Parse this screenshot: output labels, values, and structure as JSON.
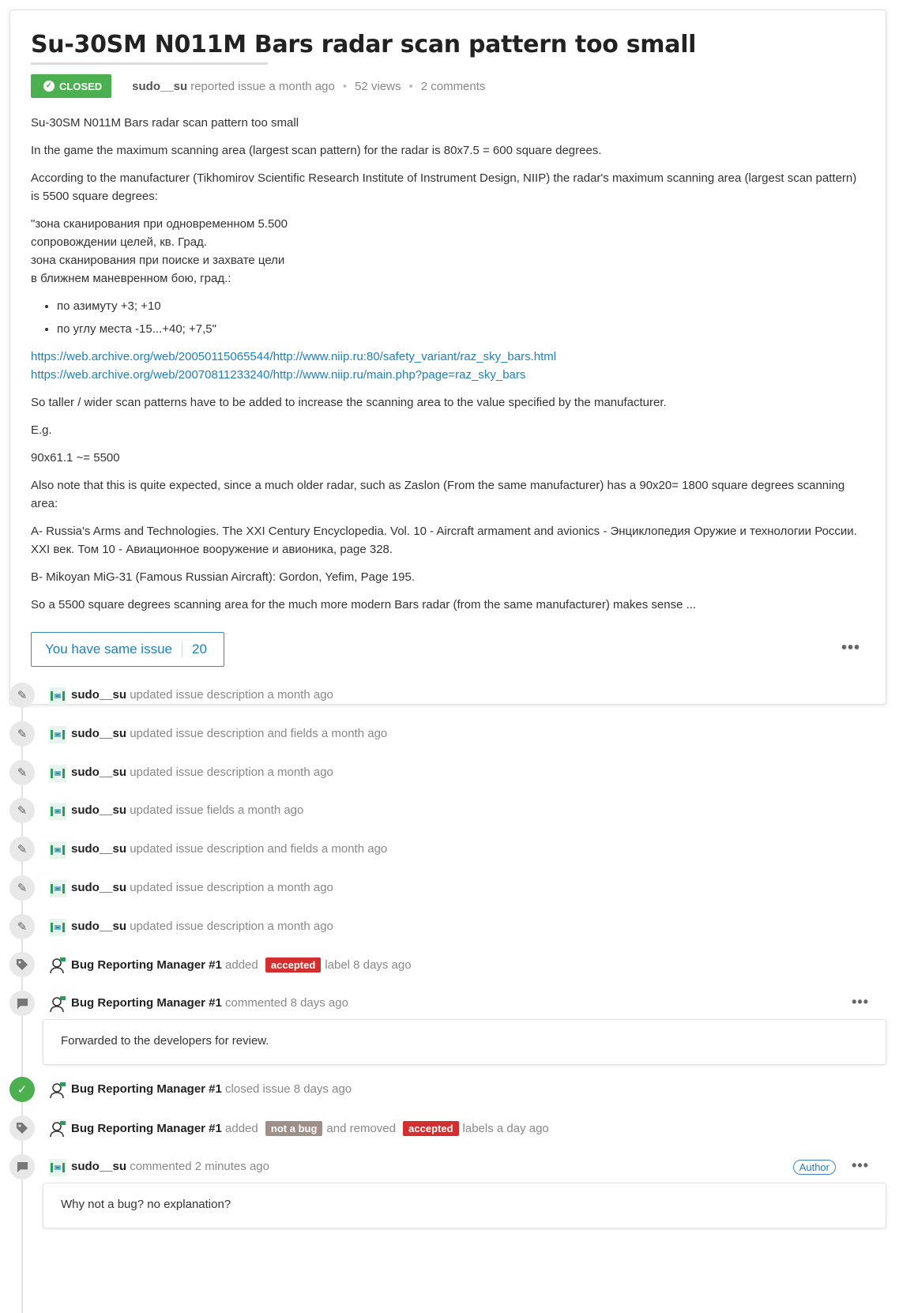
{
  "issue": {
    "title": "Su-30SM N011M Bars radar scan pattern too small",
    "status": "CLOSED",
    "reporter": "sudo__su",
    "reported_text": "reported issue a month ago",
    "views": "52 views",
    "comments": "2 comments",
    "body": {
      "p1": "Su-30SM N011M Bars radar scan pattern too small",
      "p2": "In the game the maximum scanning area (largest scan pattern) for the radar is 80x7.5 = 600 square degrees.",
      "p3": "According to the manufacturer (Tikhomirov Scientific Research Institute of Instrument Design, NIIP) the radar's maximum scanning area (largest scan pattern) is 5500 square degrees:",
      "quote1": "\"зона сканирования при одновременном 5.500",
      "quote2": "сопровождении целей, кв. Град.",
      "quote3": "зона сканирования при поиске и захвате цели",
      "quote4": "в ближнем маневренном бою, град.:",
      "bullet1": "по азимуту +3; +10",
      "bullet2": "по углу места -15...+40; +7,5\"",
      "link1": "https://web.archive.org/web/20050115065544/http://www.niip.ru:80/safety_variant/raz_sky_bars.html",
      "link2": "https://web.archive.org/web/20070811233240/http://www.niip.ru/main.php?page=raz_sky_bars",
      "p4": "So taller / wider scan patterns have to be added to increase the scanning area to the value specified by the manufacturer.",
      "p5": "E.g.",
      "p6": "90x61.1 ~= 5500",
      "p7": "Also note that this is quite expected, since a much older radar, such as Zaslon (From the same manufacturer) has a 90x20= 1800 square degrees scanning area:",
      "p8": "A- Russia's Arms and Technologies. The XXI Century Encyclopedia. Vol. 10 - Aircraft armament and avionics - Энциклопедия Оружие и технологии России. XXI век. Том 10 - Авиационное вооружение и авионика, page 328.",
      "p9": "B- Mikoyan MiG-31 (Famous Russian Aircraft): Gordon, Yefim, Page 195.",
      "p10": "So a 5500 square degrees scanning area for the much more modern Bars radar (from the same manufacturer) makes sense ..."
    },
    "same_issue_label": "You have same issue",
    "same_issue_count": "20",
    "menu_glyph": "•••"
  },
  "timeline": [
    {
      "user": "sudo__su",
      "text": "updated issue description a month ago"
    },
    {
      "user": "sudo__su",
      "text": "updated issue description and fields a month ago"
    },
    {
      "user": "sudo__su",
      "text": "updated issue description a month ago"
    },
    {
      "user": "sudo__su",
      "text": "updated issue fields a month ago"
    },
    {
      "user": "sudo__su",
      "text": "updated issue description and fields a month ago"
    },
    {
      "user": "sudo__su",
      "text": "updated issue description a month ago"
    },
    {
      "user": "sudo__su",
      "text": "updated issue description a month ago"
    },
    {
      "user": "Bug Reporting Manager #1",
      "pre": "added",
      "label": "accepted",
      "post": "label 8 days ago"
    },
    {
      "user": "Bug Reporting Manager #1",
      "text": "commented 8 days ago",
      "comment": "Forwarded to the developers for review."
    },
    {
      "user": "Bug Reporting Manager #1",
      "text": "closed issue 8 days ago"
    },
    {
      "user": "Bug Reporting Manager #1",
      "pre": "added",
      "label": "not a bug",
      "mid": "and removed",
      "label2": "accepted",
      "post": "labels a day ago"
    },
    {
      "user": "sudo__su",
      "text": "commented 2 minutes ago",
      "badge": "Author",
      "comment": "Why not a bug? no explanation?"
    }
  ],
  "colors": {
    "closed": "#4caf50",
    "accepted": "#d32f2f",
    "not_a_bug": "#9e8f88",
    "link": "#1f7fba"
  }
}
